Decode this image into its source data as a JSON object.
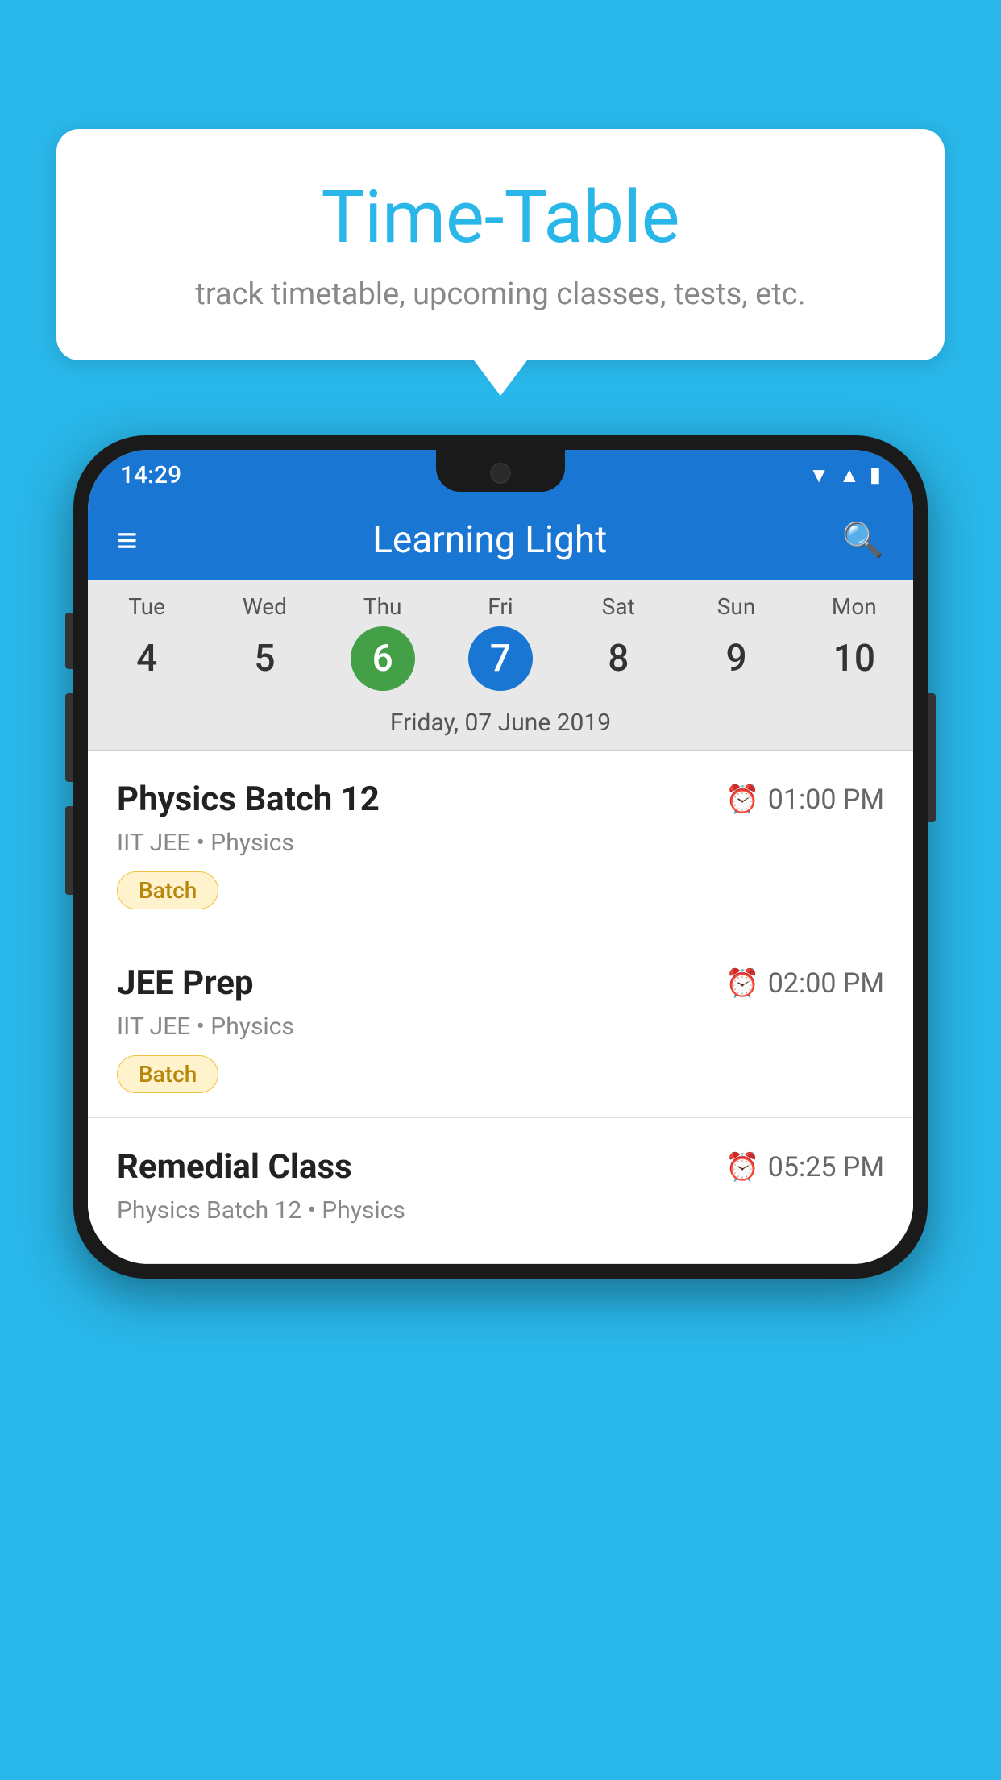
{
  "background": {
    "color": "#29b6e8"
  },
  "bubble": {
    "title": "Time-Table",
    "subtitle": "track timetable, upcoming classes, tests, etc."
  },
  "app_bar": {
    "title": "Learning Light",
    "menu_icon": "≡",
    "search_icon": "🔍"
  },
  "status_bar": {
    "time": "14:29"
  },
  "calendar": {
    "days": [
      {
        "label": "Tue",
        "num": "4"
      },
      {
        "label": "Wed",
        "num": "5"
      },
      {
        "label": "Thu",
        "num": "6",
        "state": "today"
      },
      {
        "label": "Fri",
        "num": "7",
        "state": "selected"
      },
      {
        "label": "Sat",
        "num": "8"
      },
      {
        "label": "Sun",
        "num": "9"
      },
      {
        "label": "Mon",
        "num": "10"
      }
    ],
    "selected_date": "Friday, 07 June 2019"
  },
  "classes": [
    {
      "name": "Physics Batch 12",
      "time": "01:00 PM",
      "meta": "IIT JEE • Physics",
      "badge": "Batch"
    },
    {
      "name": "JEE Prep",
      "time": "02:00 PM",
      "meta": "IIT JEE • Physics",
      "badge": "Batch"
    },
    {
      "name": "Remedial Class",
      "time": "05:25 PM",
      "meta": "Physics Batch 12 • Physics",
      "badge": ""
    }
  ]
}
